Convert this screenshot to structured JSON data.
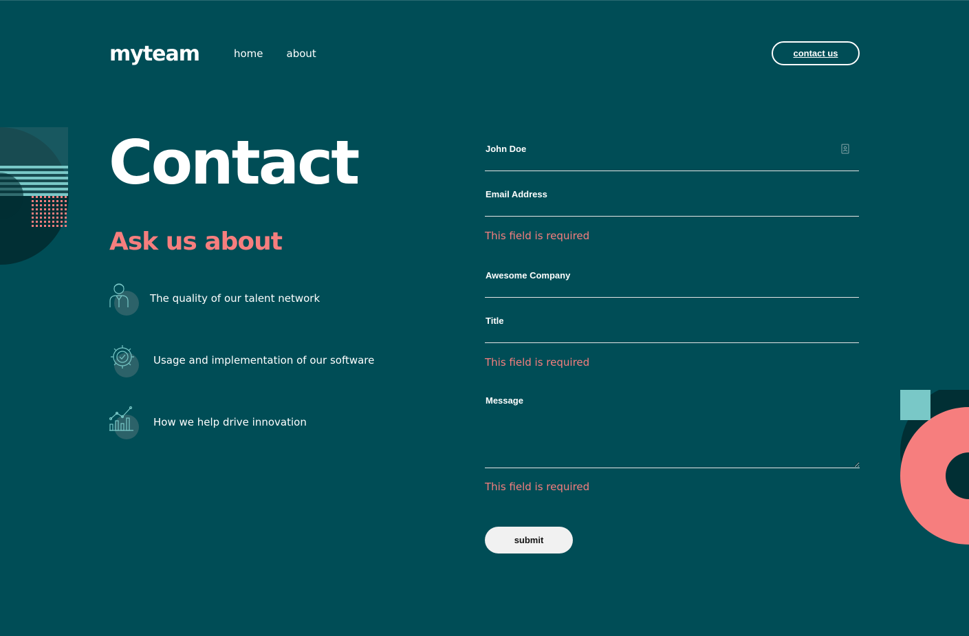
{
  "brand": {
    "logo": "myteam"
  },
  "nav": {
    "home": "home",
    "about": "about",
    "cta": "contact us"
  },
  "hero": {
    "title": "Contact",
    "subtitle": "Ask us about"
  },
  "features": [
    {
      "icon": "person-icon",
      "text": "The quality of our talent network"
    },
    {
      "icon": "gear-check-icon",
      "text": "Usage and implementation of our software"
    },
    {
      "icon": "chart-icon",
      "text": "How we help drive innovation"
    }
  ],
  "form": {
    "name_value": "John Doe",
    "email_placeholder": "Email Address",
    "company_value": "Awesome Company",
    "title_placeholder": "Title",
    "message_placeholder": "Message",
    "error_email": "This field is required",
    "error_title": "This field is required",
    "error_message": "This field is required",
    "submit": "submit"
  },
  "colors": {
    "background": "#004D56",
    "accent": "#F67E7E",
    "light_teal": "#79C8C7",
    "dark": "#012F34"
  }
}
